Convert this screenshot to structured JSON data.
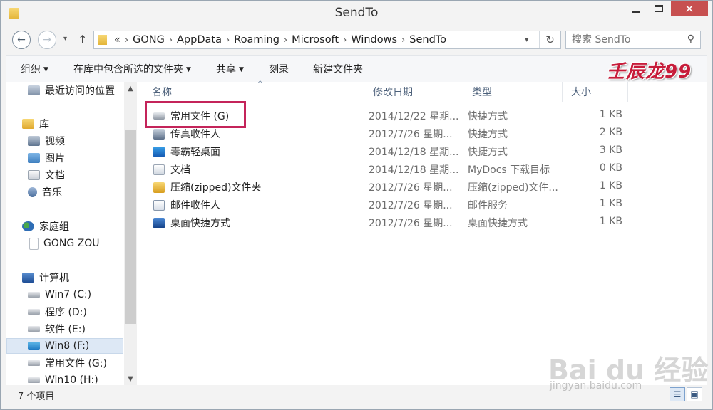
{
  "window": {
    "title": "SendTo",
    "minimize": "—",
    "close": "✕"
  },
  "nav": {
    "back": "←",
    "forward": "→",
    "recent_dropdown": "▾",
    "up": "↑",
    "breadcrumb_overflow": "«",
    "breadcrumbs": [
      "GONG",
      "AppData",
      "Roaming",
      "Microsoft",
      "Windows",
      "SendTo"
    ],
    "address_dropdown": "▾",
    "refresh": "↻",
    "search_placeholder": "搜索 SendTo",
    "search_icon": "magnifier-icon"
  },
  "toolbar": {
    "organize": "组织",
    "include_in_library": "在库中包含所选的文件夹",
    "share": "共享",
    "burn": "刻录",
    "new_folder": "新建文件夹"
  },
  "watermark": {
    "logo_text": "壬辰龙99",
    "baidu_main": "Bai du 经验",
    "baidu_sub": "jingyan.baidu.com"
  },
  "sidebar": {
    "items": [
      {
        "label": "最近访问的位置",
        "icon": "recent-places-icon"
      },
      {
        "label": "库",
        "icon": "library-icon"
      },
      {
        "label": "视频",
        "icon": "videos-icon"
      },
      {
        "label": "图片",
        "icon": "pictures-icon"
      },
      {
        "label": "文档",
        "icon": "documents-icon"
      },
      {
        "label": "音乐",
        "icon": "music-icon"
      },
      {
        "label": "家庭组",
        "icon": "homegroup-icon"
      },
      {
        "label": "GONG ZOU",
        "icon": "user-icon"
      },
      {
        "label": "计算机",
        "icon": "computer-icon"
      },
      {
        "label": "Win7 (C:)",
        "icon": "drive-icon"
      },
      {
        "label": "程序 (D:)",
        "icon": "drive-icon"
      },
      {
        "label": "软件 (E:)",
        "icon": "drive-icon"
      },
      {
        "label": "Win8 (F:)",
        "icon": "windows-drive-icon",
        "selected": true
      },
      {
        "label": "常用文件 (G:)",
        "icon": "drive-icon"
      },
      {
        "label": "Win10 (H:)",
        "icon": "drive-icon"
      }
    ]
  },
  "filelist": {
    "columns": {
      "name": "名称",
      "modified": "修改日期",
      "type": "类型",
      "size": "大小"
    },
    "sort_indicator": "^",
    "rows": [
      {
        "name": "常用文件 (G)",
        "modified": "2014/12/22 星期...",
        "type": "快捷方式",
        "size": "1 KB",
        "icon": "drive-shortcut-icon"
      },
      {
        "name": "传真收件人",
        "modified": "2012/7/26 星期...",
        "type": "快捷方式",
        "size": "2 KB",
        "icon": "fax-icon"
      },
      {
        "name": "毒霸轻桌面",
        "modified": "2014/12/18 星期...",
        "type": "快捷方式",
        "size": "3 KB",
        "icon": "app-shortcut-icon"
      },
      {
        "name": "文档",
        "modified": "2014/12/18 星期...",
        "type": "MyDocs 下载目标",
        "size": "0 KB",
        "icon": "documents-icon"
      },
      {
        "name": "压缩(zipped)文件夹",
        "modified": "2012/7/26 星期...",
        "type": "压缩(zipped)文件...",
        "size": "1 KB",
        "icon": "zip-folder-icon"
      },
      {
        "name": "邮件收件人",
        "modified": "2012/7/26 星期...",
        "type": "邮件服务",
        "size": "1 KB",
        "icon": "mail-icon"
      },
      {
        "name": "桌面快捷方式",
        "modified": "2012/7/26 星期...",
        "type": "桌面快捷方式",
        "size": "1 KB",
        "icon": "desktop-icon"
      }
    ]
  },
  "statusbar": {
    "item_count": "7 个项目",
    "details_view_icon": "details-view-icon",
    "tiles_view_icon": "large-icons-view-icon"
  },
  "colors": {
    "highlight_border": "#c4245a",
    "close_button": "#c75050",
    "selection": "#dde8f5"
  }
}
